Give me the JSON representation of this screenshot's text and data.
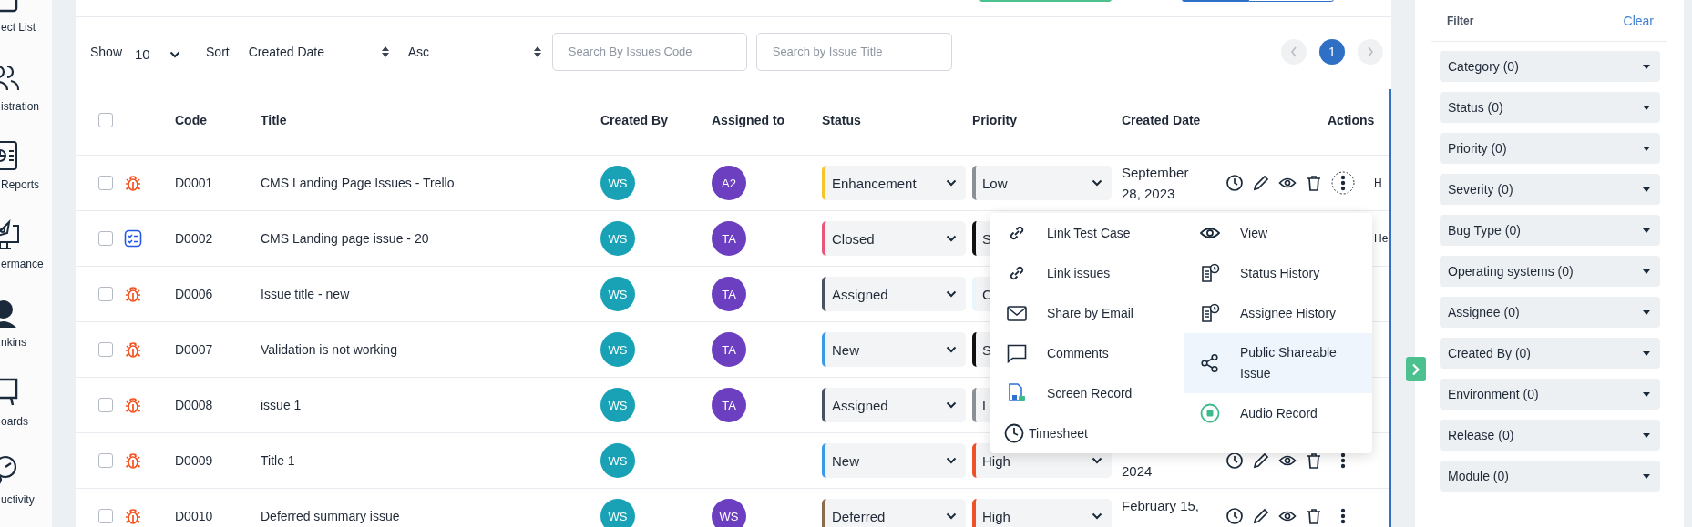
{
  "sidebar": {
    "items": [
      {
        "label": "ect List",
        "kind": "board"
      },
      {
        "label": "istration",
        "kind": "people"
      },
      {
        "label": " Reports",
        "kind": "report"
      },
      {
        "label": "ermance",
        "kind": "rocket"
      },
      {
        "label": "nkins",
        "kind": "person"
      },
      {
        "label": "oards",
        "kind": "easel"
      },
      {
        "label": "uctivity",
        "kind": "gauge"
      }
    ]
  },
  "toolbar": {
    "show_label": "Show",
    "page_size": "10",
    "sort_label": "Sort",
    "sort_field": "Created Date",
    "sort_order": "Asc",
    "search_code": {
      "placeholder": "Search By Issues Code"
    },
    "search_title": {
      "placeholder": "Search by Issue Title"
    },
    "pages": [
      {
        "label": "1",
        "selected": true
      }
    ]
  },
  "table": {
    "select_all": {
      "checked": false
    },
    "columns": [
      "Code",
      "Title",
      "Created By",
      "Assigned to",
      "Status",
      "Priority",
      "Created Date",
      "Actions"
    ],
    "rows": [
      {
        "checked": false,
        "kind": "bug",
        "code": "D0001",
        "title": "CMS Landing Page Issues - Trello",
        "created_by": {
          "initials": "WS",
          "color": "#19a2b6"
        },
        "assigned_to": {
          "initials": "A2",
          "color": "#6b3fbf"
        },
        "status": {
          "label": "Enhancement",
          "color": "#f8c42c"
        },
        "priority": {
          "label": "Low",
          "color": "#8b8f96"
        },
        "created_date": {
          "line_1": "September",
          "line_2": "28, 2023"
        },
        "show_actions": true,
        "menu_open": true,
        "column_10": "H"
      },
      {
        "checked": false,
        "kind": "checklist",
        "code": "D0002",
        "title": "CMS Landing page issue - 20",
        "created_by": {
          "initials": "WS",
          "color": "#19a2b6"
        },
        "assigned_to": {
          "initials": "TA",
          "color": "#6b3fbf"
        },
        "status": {
          "label": "Closed",
          "color": "#e8567c"
        },
        "priority": {
          "label": "S",
          "color": "#111111"
        },
        "column_10": "He"
      },
      {
        "checked": false,
        "kind": "bug",
        "code": "D0006",
        "title": "Issue title - new",
        "created_by": {
          "initials": "WS",
          "color": "#19a2b6"
        },
        "assigned_to": {
          "initials": "TA",
          "color": "#6b3fbf"
        },
        "status": {
          "label": "Assigned",
          "color": "#4a5262"
        },
        "priority": {
          "label": "C",
          "color": "#e6f6fa"
        }
      },
      {
        "checked": false,
        "kind": "bug",
        "code": "D0007",
        "title": "Validation is not working",
        "created_by": {
          "initials": "WS",
          "color": "#19a2b6"
        },
        "assigned_to": {
          "initials": "TA",
          "color": "#6b3fbf"
        },
        "status": {
          "label": "New",
          "color": "#3a9ae8"
        },
        "priority": {
          "label": "S",
          "color": "#111111"
        }
      },
      {
        "checked": false,
        "kind": "bug",
        "code": "D0008",
        "title": "issue 1",
        "created_by": {
          "initials": "WS",
          "color": "#19a2b6"
        },
        "assigned_to": {
          "initials": "TA",
          "color": "#6b3fbf"
        },
        "status": {
          "label": "Assigned",
          "color": "#4a5262"
        },
        "priority": {
          "label": "L",
          "color": "#8b8f96"
        }
      },
      {
        "checked": false,
        "kind": "bug",
        "code": "D0009",
        "title": "Title 1",
        "created_by": {
          "initials": "WS",
          "color": "#19a2b6"
        },
        "status": {
          "label": "New",
          "color": "#3a9ae8"
        },
        "priority": {
          "label": "High",
          "color": "#ef5128"
        },
        "created_date": {
          "line_2": "2024"
        },
        "show_actions": true,
        "menu_open": false
      },
      {
        "checked": false,
        "kind": "bug",
        "code": "D0010",
        "title": "Deferred summary issue",
        "created_by": {
          "initials": "WS",
          "color": "#19a2b6"
        },
        "assigned_to": {
          "initials": "WS",
          "color": "#6b3fbf"
        },
        "status": {
          "label": "Deferred",
          "color": "#8d6e4c"
        },
        "priority": {
          "label": "High",
          "color": "#ef5128"
        },
        "created_date": {
          "line_1": "February 15,"
        },
        "show_actions": true,
        "menu_open": false
      }
    ]
  },
  "context_menu": {
    "left_items": [
      {
        "label": "Link Test Case"
      },
      {
        "label": "Link issues"
      },
      {
        "label": "Share by Email"
      },
      {
        "label": "Comments"
      },
      {
        "label": "Screen Record"
      },
      {
        "label": "Timesheet"
      }
    ],
    "right_items": [
      {
        "label": "View",
        "selected": false
      },
      {
        "label": "Status History",
        "selected": false
      },
      {
        "label": "Assignee History",
        "selected": false
      },
      {
        "label": "Public Shareable Issue",
        "selected": true
      },
      {
        "label": "Audio Record",
        "selected": false
      }
    ]
  },
  "filter_panel": {
    "title": "Filter",
    "clear": "Clear",
    "dropdowns": [
      "Category (0)",
      "Status (0)",
      "Priority (0)",
      "Severity (0)",
      "Bug Type (0)",
      "Operating systems (0)",
      "Assignee (0)",
      "Created By (0)",
      "Environment (0)",
      "Release (0)",
      "Module (0)"
    ]
  }
}
